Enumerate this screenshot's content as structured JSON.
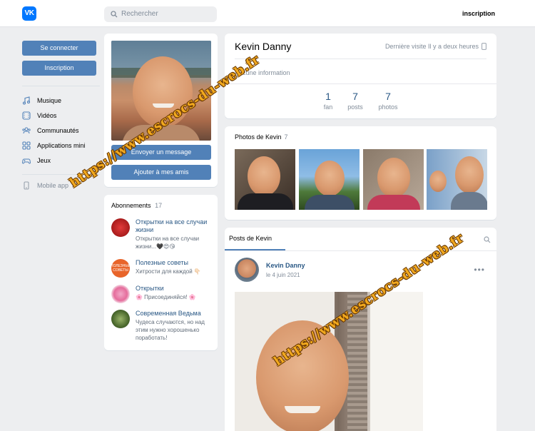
{
  "header": {
    "logo_text": "VK",
    "search_placeholder": "Rechercher",
    "signup_link": "inscription"
  },
  "sidebar": {
    "login_label": "Se connecter",
    "signup_label": "Inscription",
    "items": [
      {
        "label": "Musique",
        "icon": "music-icon"
      },
      {
        "label": "Vidéos",
        "icon": "video-icon"
      },
      {
        "label": "Communautés",
        "icon": "people-icon"
      },
      {
        "label": "Applications mini",
        "icon": "apps-icon"
      },
      {
        "label": "Jeux",
        "icon": "gamepad-icon"
      }
    ],
    "mobile_label": "Mobile app"
  },
  "profile": {
    "send_message_label": "Envoyer un message",
    "add_friend_label": "Ajouter à mes amis",
    "name": "Kevin Danny",
    "last_seen": "Dernière visite Il y a deux heures",
    "info": "Aucune information",
    "stats": [
      {
        "value": "1",
        "label": "fan"
      },
      {
        "value": "7",
        "label": "posts"
      },
      {
        "value": "7",
        "label": "photos"
      }
    ]
  },
  "subscriptions": {
    "title": "Abonnements",
    "count": "17",
    "items": [
      {
        "name": "Открытки на все случаи жизни",
        "desc": "Открытки на все случаи жизни...🖤😍😘"
      },
      {
        "name": "Полезные советы",
        "desc": "Хитрости для каждой 👇🏻",
        "avatar_text": "ПОЛЕЗНЫЕ СОВЕТЫ"
      },
      {
        "name": "Открытки",
        "desc": "🌸 Присоединяйся! 🌸"
      },
      {
        "name": "Современная Ведьма",
        "desc": "Чудеса случаются, но над этим нужно хорошенько поработать!"
      }
    ]
  },
  "photos": {
    "title": "Photos de Kevin",
    "count": "7"
  },
  "posts": {
    "tab_label": "Posts de Kevin",
    "author": "Kevin Danny",
    "date": "le 4 juin 2021"
  },
  "watermark": "https://www.escrocs-du-web.fr",
  "colors": {
    "accent": "#5181b8",
    "link": "#2a5885",
    "background": "#edeef0",
    "watermark": "#f2a91f"
  }
}
